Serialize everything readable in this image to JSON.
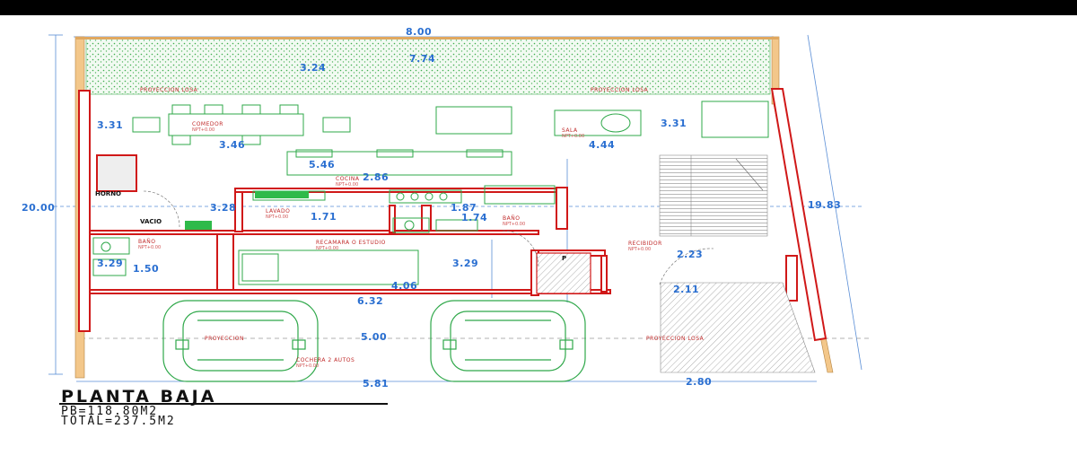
{
  "title": "PLANTA BAJA",
  "areas": {
    "pb": "PB=118.80M2",
    "total": "TOTAL=237.5M2"
  },
  "dimensions": {
    "top_width": "8.00",
    "garden_depth": "3.24",
    "garden_width": "7.74",
    "dining_w": "3.31",
    "living_w": "3.31",
    "d346": "3.46",
    "d444": "4.44",
    "d546": "5.46",
    "d286": "2.86",
    "left_height": "20.00",
    "right_height": "19.83",
    "d328": "3.28",
    "d171": "1.71",
    "d187": "1.87",
    "d174": "1.74",
    "d329a": "3.29",
    "d150": "1.50",
    "d329b": "3.29",
    "d223": "2.23",
    "d406": "4.06",
    "d211": "2.11",
    "d632": "6.32",
    "d500": "5.00",
    "bottom_left": "5.81",
    "bottom_right": "2.80"
  },
  "labels": {
    "proy_left": "PROYECCION LOSA",
    "proy_right": "PROYECCION LOSA",
    "comedor": "COMEDOR",
    "comedor_sub": "NPT+0.00",
    "sala": "SALA",
    "sala_sub": "NPT+0.00",
    "cocina": "COCINA",
    "cocina_sub": "NPT+0.00",
    "lavado": "LAVADO",
    "lavado_sub": "NPT+0.00",
    "bano_left": "BAÑO",
    "bano_left_sub": "NPT+0.00",
    "bano_right": "BAÑO",
    "bano_right_sub": "NPT+0.00",
    "recamara": "RECAMARA O ESTUDIO",
    "recamara_sub": "NPT+0.00",
    "recibidor": "RECIBIDOR",
    "recibidor_sub": "NPT+0.00",
    "horno": "HORNO",
    "vacio": "VACIO",
    "block_p": "P",
    "proy_garage": "PROYECCION",
    "proy_garage2": "PROYECCION LOSA",
    "cochera": "COCHERA 2 AUTOS",
    "cochera_sub": "NPT+0.00"
  }
}
